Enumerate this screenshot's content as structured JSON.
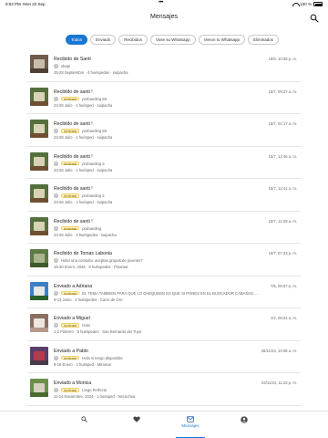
{
  "status_bar": {
    "time": "9:53 PM",
    "date": "Mon 22 Sep",
    "dots": "•••",
    "battery": "100 %"
  },
  "header": {
    "title": "Mensajes",
    "search_icon": "search-icon"
  },
  "filters": [
    {
      "label": "Todos",
      "active": true
    },
    {
      "label": "Enviado",
      "active": false
    },
    {
      "label": "Recibidos",
      "active": false
    },
    {
      "label": "Vose su Whatsapp",
      "active": false
    },
    {
      "label": "Vieron tu Whatsapp",
      "active": false
    },
    {
      "label": "Eliminados",
      "active": false
    }
  ],
  "messages": [
    {
      "title": "Recibido de Santi",
      "date": "18/9, 10:35 p. m.",
      "sender": "okapi",
      "badge": "",
      "details": "25-28 Septiembre · 4 huéspedes · suipacha",
      "thumb": [
        "#6d5a4b",
        "#c8bca9",
        "#4e3f34"
      ]
    },
    {
      "title": "Recibido de santi !",
      "date": "15/7, 09:27 a. m.",
      "sender": "probanding 56",
      "badge": "Archivado",
      "details": "23-26 Julio · 1 huésped · suipacha",
      "thumb": [
        "#55703d",
        "#d9d2b4",
        "#6f4f32"
      ]
    },
    {
      "title": "Recibido de santi !",
      "date": "15/7, 01:17 a. m.",
      "sender": "probanding 55",
      "badge": "Archivado",
      "details": "23-26 Julio · 1 huésped · suipacha",
      "thumb": [
        "#55703d",
        "#d9d2b4",
        "#6f4f32"
      ]
    },
    {
      "title": "Recibido de santi !",
      "date": "15/7, 12:46 a. m.",
      "sender": "probanding 3",
      "badge": "Archivado",
      "details": "23-26 Julio · 1 huésped · suipacha",
      "thumb": [
        "#55703d",
        "#d9d2b4",
        "#6f4f32"
      ]
    },
    {
      "title": "Recibido de santi !",
      "date": "15/7, 12:41 a. m.",
      "sender": "probanding 2",
      "badge": "Archivado",
      "details": "23-26 Julio · 1 huésped · suipacha",
      "thumb": [
        "#55703d",
        "#d9d2b4",
        "#6f4f32"
      ]
    },
    {
      "title": "Recibido de santi !",
      "date": "15/7, 12:28 a. m.",
      "sender": "probanding",
      "badge": "Archivado",
      "details": "23-26 Julio · 2 huéspedes · suipacha",
      "thumb": [
        "#55703d",
        "#d9d2b4",
        "#6f4f32"
      ]
    },
    {
      "title": "Recibido de Tomas Labonia",
      "date": "10/7, 07:33 p. m.",
      "sender": "Hola! una consulta, aceptan grupos de jovenes?",
      "badge": "",
      "details": "15-30 Enero, 2026 · 6 huéspedes · Pinamar",
      "thumb": [
        "#5f7a45",
        "#a9b58c",
        "#3f5a2a"
      ]
    },
    {
      "title": "Enviado a Adriana",
      "date": "7/5, 09:07 p. m.",
      "sender": "EL TEMA TAMBIEN PARA QUE LO CHEQUEEN ES QUE SI PONES EN EL BUSCADOR CABAÑAS ...",
      "badge": "Archivado",
      "details": "9-13 Junio · 4 huéspedes · Carro de Oro",
      "thumb": [
        "#3f7fc4",
        "#e8e8e8",
        "#2b5f2b"
      ]
    },
    {
      "title": "Enviado a Miguel",
      "date": "1/2, 08:24 a. m.",
      "sender": "Hola",
      "badge": "Archivado",
      "details": "1-2 Febrero · 5 huéspedes · San Bernardo del Tuyú",
      "thumb": [
        "#8a6f62",
        "#efe6e0",
        "#b59a8c"
      ]
    },
    {
      "title": "Enviado a Pablo",
      "date": "25/11/24, 10:08 a. m.",
      "sender": "Hola si tengo disponible",
      "badge": "Archivado",
      "details": "8-16 Enero · 1 huésped · Miramar",
      "thumb": [
        "#5a3f6b",
        "#b63a4a",
        "#4a3a4a"
      ]
    },
    {
      "title": "Enviado a Monica",
      "date": "04/11/24, 11:23 p. m.",
      "sender": "Llego Perfecto",
      "badge": "Archivado",
      "details": "11-14 Noviembre, 2024 · 1 huésped · Necochea",
      "thumb": [
        "#6a8f4a",
        "#d8d0c0",
        "#4a6a30"
      ]
    }
  ],
  "tabbar": [
    {
      "icon": "search-icon",
      "label": ""
    },
    {
      "icon": "heart-icon",
      "label": ""
    },
    {
      "icon": "mail-icon",
      "label": "Mensajes",
      "active": true
    },
    {
      "icon": "account-icon",
      "label": ""
    }
  ],
  "colors": {
    "accent": "#1976d2",
    "badge_bg": "#fff4c4"
  }
}
